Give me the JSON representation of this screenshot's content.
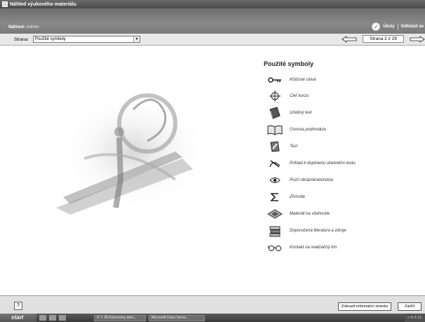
{
  "window": {
    "title": "Náhled výukového materiálu"
  },
  "header": {
    "preview_label": "Náhled:",
    "preview_user": "Admin",
    "tasks_label": "Úkoly",
    "logout_label": "Odhlásit se"
  },
  "nav": {
    "page_label": "Strana:",
    "page_select_value": "Použité symboly",
    "pager_text": "Strana  2 z 29"
  },
  "content": {
    "title": "Použité symboly",
    "symbols": [
      {
        "icon": "key-icon",
        "label": "Kľúčové slová"
      },
      {
        "icon": "crosshair-icon",
        "label": "Cieľ kurzu"
      },
      {
        "icon": "book-icon",
        "label": "Učebný text"
      },
      {
        "icon": "open-book-icon",
        "label": "Osnova podmodulu"
      },
      {
        "icon": "test-pencil-icon",
        "label": "Test"
      },
      {
        "icon": "hand-pencil-icon",
        "label": "Príklad k doplneniu učebného textu"
      },
      {
        "icon": "eye-icon",
        "label": "Pozri obrázok/animáciu"
      },
      {
        "icon": "sigma-icon",
        "label": "Zhrnutie"
      },
      {
        "icon": "diskette-icon",
        "label": "Materiál na stiahnutie"
      },
      {
        "icon": "books-stack-icon",
        "label": "Doporučená literatúra a zdroje"
      },
      {
        "icon": "glasses-icon",
        "label": "Kontakt na realizačný tím"
      }
    ]
  },
  "footer": {
    "help_label": "?",
    "info_page_button": "Zobrazit informační stránku",
    "close_button": "Zavřít"
  },
  "taskbar": {
    "start_label": "start",
    "tasks": [
      "® 7. 00 Astronomy dem...",
      "Microsoft Class Serve..."
    ],
    "tray_text": "« © © 11:"
  }
}
